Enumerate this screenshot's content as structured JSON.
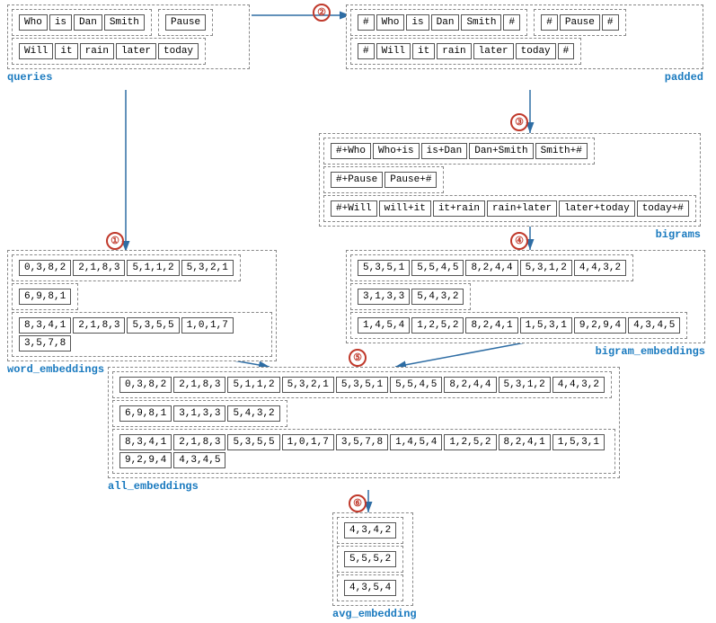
{
  "labels": {
    "queries": "queries",
    "padded": "padded",
    "bigrams": "bigrams",
    "word_embeddings": "word_embeddings",
    "bigram_embeddings": "bigram_embeddings",
    "all_embeddings": "all_embeddings",
    "avg_embedding": "avg_embedding"
  },
  "queries": {
    "row1": [
      "Who",
      "is",
      "Dan",
      "Smith"
    ],
    "row2": [
      "Pause"
    ],
    "row3": [
      "Will",
      "it",
      "rain",
      "later",
      "today"
    ]
  },
  "padded": {
    "row1": [
      "#",
      "Who",
      "is",
      "Dan",
      "Smith",
      "#"
    ],
    "row2": [
      "#",
      "Pause",
      "#"
    ],
    "row3": [
      "#",
      "Will",
      "it",
      "rain",
      "later",
      "today",
      "#"
    ]
  },
  "bigrams": {
    "row1": [
      "#+Who",
      "Who+is",
      "is+Dan",
      "Dan+Smith",
      "Smith+#"
    ],
    "row2": [
      "#+Pause",
      "Pause+#"
    ],
    "row3": [
      "#+Will",
      "will+it",
      "it+rain",
      "rain+later",
      "later+today",
      "today+#"
    ]
  },
  "word_embeddings": {
    "row1": [
      "0,3,8,2",
      "2,1,8,3",
      "5,1,1,2",
      "5,3,2,1"
    ],
    "row2": [
      "6,9,8,1"
    ],
    "row3": [
      "8,3,4,1",
      "2,1,8,3",
      "5,3,5,5",
      "1,0,1,7",
      "3,5,7,8"
    ]
  },
  "bigram_embeddings": {
    "row1": [
      "5,3,5,1",
      "5,5,4,5",
      "8,2,4,4",
      "5,3,1,2",
      "4,4,3,2"
    ],
    "row2": [
      "3,1,3,3",
      "5,4,3,2"
    ],
    "row3": [
      "1,4,5,4",
      "1,2,5,2",
      "8,2,4,1",
      "1,5,3,1",
      "9,2,9,4",
      "4,3,4,5"
    ]
  },
  "all_embeddings": {
    "row1": [
      "0,3,8,2",
      "2,1,8,3",
      "5,1,1,2",
      "5,3,2,1",
      "5,3,5,1",
      "5,5,4,5",
      "8,2,4,4",
      "5,3,1,2",
      "4,4,3,2"
    ],
    "row2": [
      "6,9,8,1",
      "3,1,3,3",
      "5,4,3,2"
    ],
    "row3": [
      "8,3,4,1",
      "2,1,8,3",
      "5,3,5,5",
      "1,0,1,7",
      "3,5,7,8",
      "1,4,5,4",
      "1,2,5,2",
      "8,2,4,1",
      "1,5,3,1",
      "9,2,9,4",
      "4,3,4,5"
    ]
  },
  "avg_embedding": {
    "row1": [
      "4,3,4,2"
    ],
    "row2": [
      "5,5,5,2"
    ],
    "row3": [
      "4,3,5,4"
    ]
  },
  "step_numbers": [
    "①",
    "②",
    "③",
    "④",
    "⑤",
    "⑥"
  ]
}
